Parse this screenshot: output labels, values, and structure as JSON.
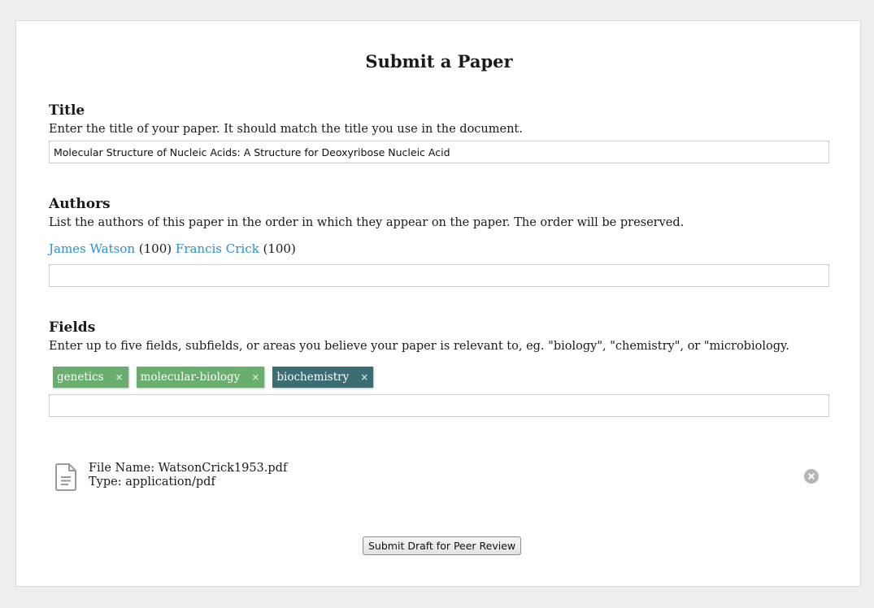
{
  "page": {
    "title": "Submit a Paper"
  },
  "title_section": {
    "heading": "Title",
    "description": "Enter the title of your paper. It should match the title you use in the document.",
    "value": "Molecular Structure of Nucleic Acids: A Structure for Deoxyribose Nucleic Acid"
  },
  "authors_section": {
    "heading": "Authors",
    "description": "List the authors of this paper in the order in which they appear on the paper. The order will be preserved.",
    "authors": [
      {
        "name": "James Watson",
        "score": "(100)"
      },
      {
        "name": "Francis Crick",
        "score": "(100)"
      }
    ],
    "input_value": ""
  },
  "fields_section": {
    "heading": "Fields",
    "description": "Enter up to five fields, subfields, or areas you believe your paper is relevant to, eg. \"biology\", \"chemistry\", or \"microbiology.",
    "tags": [
      {
        "label": "genetics",
        "remove": "×",
        "color": "#6aae6f"
      },
      {
        "label": "molecular-biology",
        "remove": "×",
        "color": "#6aae6f"
      },
      {
        "label": "biochemistry",
        "remove": "×",
        "color": "#3c6d72"
      }
    ],
    "input_value": ""
  },
  "file": {
    "name_line": "File Name: WatsonCrick1953.pdf",
    "type_line": "Type: application/pdf",
    "icon": "document-icon",
    "remove_icon": "close-circle-icon"
  },
  "actions": {
    "submit_label": "Submit Draft for Peer Review"
  },
  "colors": {
    "link": "#2b8fd6",
    "tag_green": "#6aae6f",
    "tag_active": "#3c6d72"
  }
}
